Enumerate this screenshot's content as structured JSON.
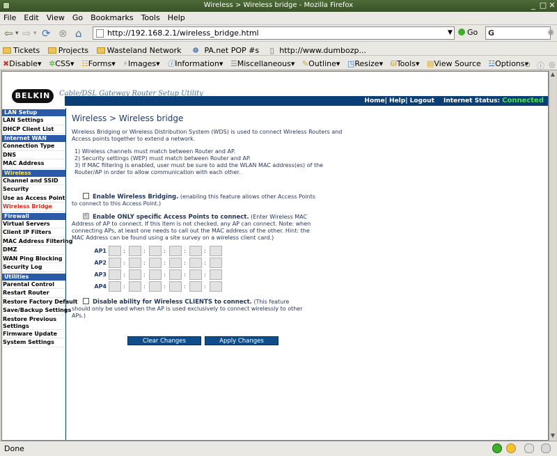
{
  "window": {
    "title": "Wireless > Wireless bridge - Mozilla Firefox"
  },
  "menubar": [
    "File",
    "Edit",
    "View",
    "Go",
    "Bookmarks",
    "Tools",
    "Help"
  ],
  "navbar": {
    "url": "http://192.168.2.1/wireless_bridge.html",
    "go_label": "Go",
    "search_value": "G"
  },
  "bookmarks": [
    "Tickets",
    "Projects",
    "Wasteland Network",
    "PA.net POP #s",
    "http://www.dumbozp..."
  ],
  "devtoolbar": [
    "Disable",
    "CSS",
    "Forms",
    "Images",
    "Information",
    "Miscellaneous",
    "Outline",
    "Resize",
    "Tools",
    "View Source",
    "Options"
  ],
  "header": {
    "logo": "BELKIN",
    "tagline": "Cable/DSL Gateway Router Setup Utility",
    "links": "Home| Help| Logout",
    "internet_status_label": "Internet Status:",
    "internet_status_value": "Connected"
  },
  "sidebar": {
    "lan_setup": "LAN Setup",
    "lan_settings": "LAN Settings",
    "dhcp_client_list": "DHCP Client List",
    "internet_wan": "Internet WAN",
    "connection_type": "Connection Type",
    "dns": "DNS",
    "mac_address": "MAC Address",
    "wireless": "Wireless",
    "channel_ssid": "Channel and SSID",
    "security": "Security",
    "use_as_ap": "Use as Access Point",
    "wireless_bridge": "Wireless Bridge",
    "firewall": "Firewall",
    "virtual_servers": "Virtual Servers",
    "client_ip_filters": "Client IP Filters",
    "mac_address_filtering": "MAC Address Filtering",
    "dmz": "DMZ",
    "wan_ping_blocking": "WAN Ping Blocking",
    "security_log": "Security Log",
    "utilities": "Utilities",
    "parental_control": "Parental Control",
    "restart_router": "Restart Router",
    "restore_factory": "Restore Factory Default",
    "save_backup": "Save/Backup Settings",
    "restore_previous": "Restore Previous Settings",
    "firmware_update": "Firmware Update",
    "system_settings": "System Settings"
  },
  "main": {
    "title": "Wireless > Wireless bridge",
    "intro": "Wireless Bridging or Wireless Distribution System (WDS) is used to connect Wireless Routers and Access points together to extend a network.",
    "req1": "1) Wireless channels must match between Router and AP.",
    "req2": "2) Security settings (WEP) must match between Router and AP.",
    "req3": "3) If MAC filtering is enabled, user must be sure to add the WLAN MAC address(es) of the Router/AP in order to allow communication with each other.",
    "opt1_label": "Enable Wireless Bridging.",
    "opt1_desc": " (enabling this feature allows other Access Points to connect to this Access Point.)",
    "opt2_label": "Enable ONLY specific Access Points to connect.",
    "opt2_desc": " (Enter Wireless MAC Address of AP to connect. If this Item is not checked, any AP can connect. Note: when connecting APs, at least one needs to call out the MAC address of the other. Hint: the MAC Address can be found using a site survey on a wireless client card.)",
    "ap_labels": [
      "AP1",
      "AP2",
      "AP3",
      "AP4"
    ],
    "opt3_label": "Disable ability for Wireless CLIENTS to connect.",
    "opt3_desc": " (This feature should only be used when the AP is used exclusively to connect wirelessly to other APs.)",
    "clear_button": "Clear Changes",
    "apply_button": "Apply Changes"
  },
  "status": {
    "text": "Done"
  },
  "colors": {
    "accent": "#0a3e76",
    "connected": "#4ee24e",
    "selected_item": "#e02a1b"
  }
}
